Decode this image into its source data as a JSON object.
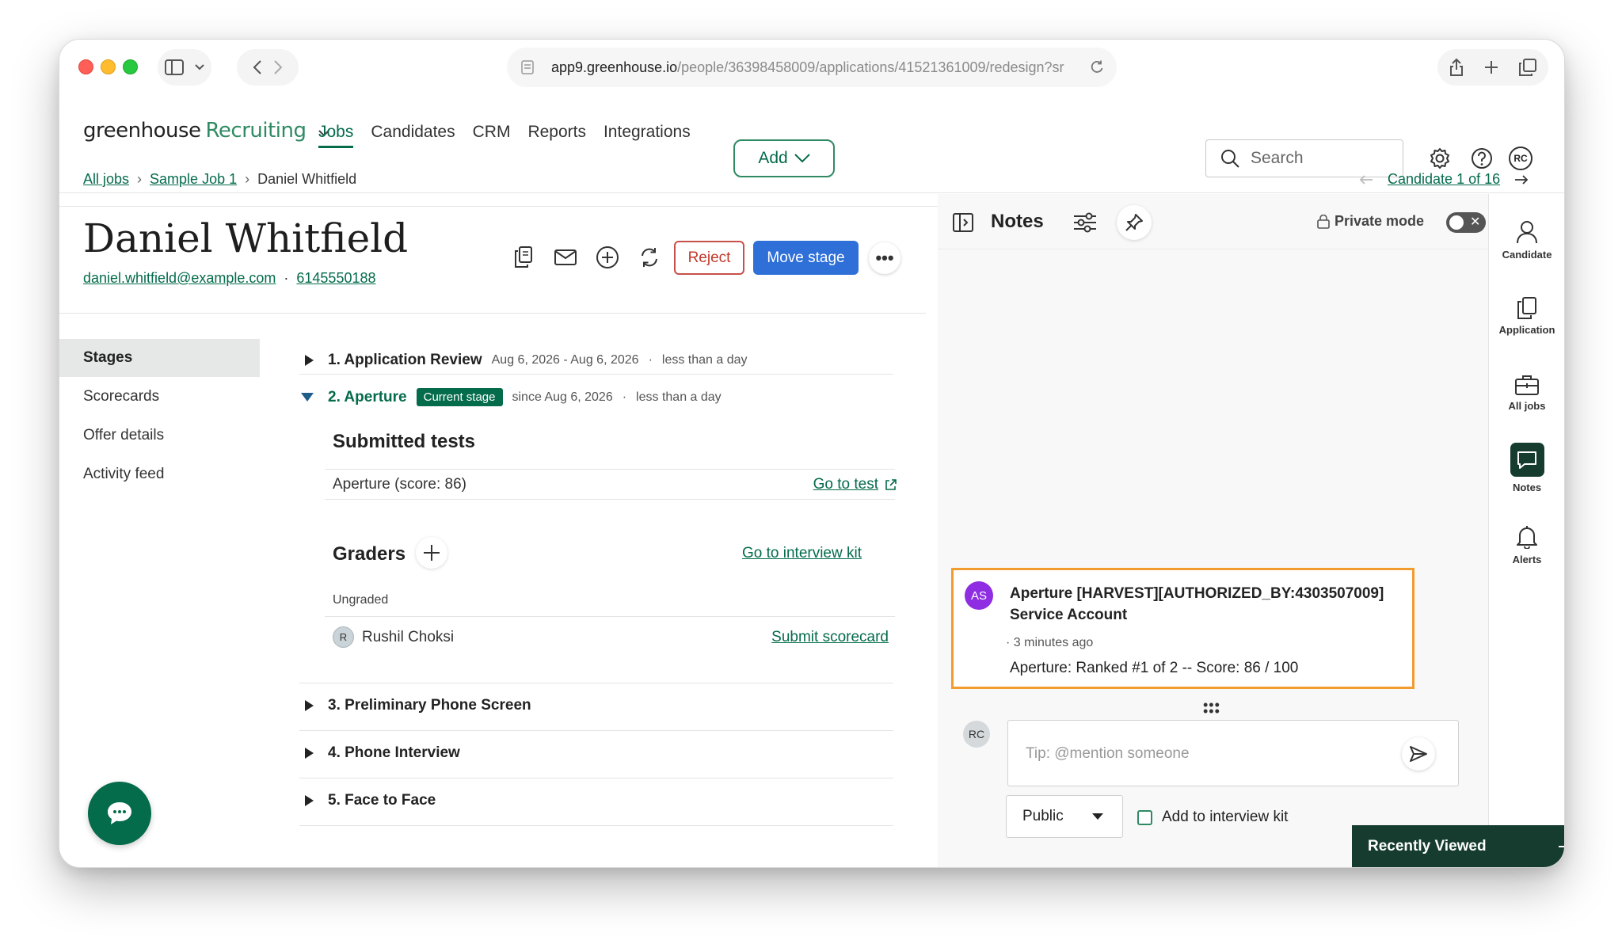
{
  "browser": {
    "url_host": "app9.greenhouse.io",
    "url_path": "/people/36398458009/applications/41521361009/redesign?sr"
  },
  "app": {
    "logo_primary": "greenhouse",
    "logo_secondary": "Recruiting",
    "nav": [
      "Jobs",
      "Candidates",
      "CRM",
      "Reports",
      "Integrations"
    ],
    "add_label": "Add",
    "search_placeholder": "Search",
    "user_initials": "RC"
  },
  "breadcrumb": {
    "all_jobs": "All jobs",
    "job": "Sample Job 1",
    "current": "Daniel Whitfield",
    "candidate_nav": "Candidate 1 of 16"
  },
  "candidate": {
    "name": "Daniel Whitfield",
    "email": "daniel.whitfield@example.com",
    "phone": "6145550188",
    "reject_label": "Reject",
    "move_stage_label": "Move stage"
  },
  "left_menu": [
    "Stages",
    "Scorecards",
    "Offer details",
    "Activity feed"
  ],
  "stages": [
    {
      "title": "1. Application Review",
      "dates": "Aug 6, 2026 - Aug 6, 2026",
      "duration": "less than a day"
    },
    {
      "title": "2. Aperture",
      "badge": "Current stage",
      "dates": "since Aug 6, 2026",
      "duration": "less than a day"
    },
    {
      "title": "3. Preliminary Phone Screen"
    },
    {
      "title": "4. Phone Interview"
    },
    {
      "title": "5. Face to Face"
    }
  ],
  "current_stage": {
    "submitted_tests_title": "Submitted tests",
    "test_name": "Aperture (score: 86)",
    "go_to_test": "Go to test",
    "graders_title": "Graders",
    "go_to_kit": "Go to interview kit",
    "ungraded": "Ungraded",
    "grader_initial": "R",
    "grader_name": "Rushil Choksi",
    "submit_scorecard": "Submit scorecard"
  },
  "notes": {
    "title": "Notes",
    "private_mode": "Private mode",
    "note": {
      "avatar": "AS",
      "author_line1": "Aperture [HARVEST][AUTHORIZED_BY:4303507009]",
      "author_line2": "Service Account",
      "time": "3 minutes ago",
      "body": "Aperture: Ranked #1 of 2 -- Score: 86 / 100"
    },
    "composer_avatar": "RC",
    "composer_placeholder": "Tip: @mention someone",
    "visibility": "Public",
    "add_to_kit": "Add to interview kit"
  },
  "rail": [
    "Candidate",
    "Application",
    "All jobs",
    "Notes",
    "Alerts"
  ],
  "recently_viewed": "Recently Viewed",
  "colors": {
    "brand_green": "#046b4b",
    "primary_blue": "#2e6fd8",
    "reject_red": "#c0392b",
    "highlight_orange": "#f29c2f",
    "dark_green": "#153c2f"
  }
}
